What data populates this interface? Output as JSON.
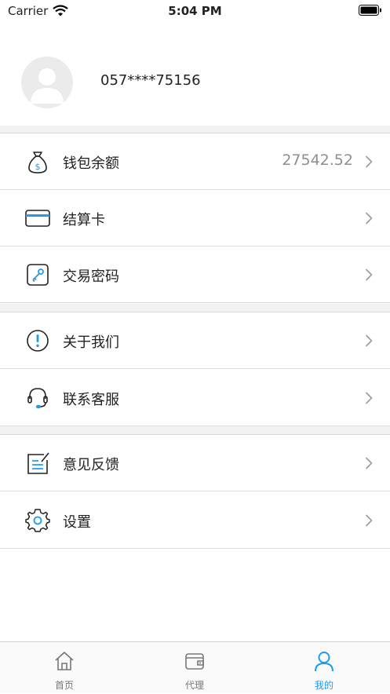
{
  "status_bar": {
    "carrier": "Carrier",
    "time": "5:04 PM"
  },
  "profile": {
    "phone": "057****75156"
  },
  "menu": {
    "wallet": {
      "label": "钱包余额",
      "value": "27542.52"
    },
    "card": {
      "label": "结算卡"
    },
    "password": {
      "label": "交易密码"
    },
    "about": {
      "label": "关于我们"
    },
    "support": {
      "label": "联系客服"
    },
    "feedback": {
      "label": "意见反馈"
    },
    "settings": {
      "label": "设置"
    }
  },
  "tabbar": {
    "home": "首页",
    "agent": "代理",
    "mine": "我的"
  },
  "colors": {
    "accent": "#1e9bf0",
    "icon": "#222222"
  }
}
